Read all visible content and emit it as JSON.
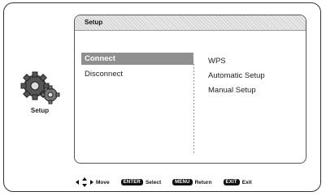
{
  "side": {
    "label": "Setup",
    "icon": "gear-icon"
  },
  "panel": {
    "title": "Setup"
  },
  "menu": {
    "items": [
      {
        "label": "Connect",
        "selected": true
      },
      {
        "label": "Disconnect",
        "selected": false
      }
    ]
  },
  "options": {
    "items": [
      "WPS",
      "Automatic Setup",
      "Manual Setup"
    ]
  },
  "footer": {
    "move_label": "Move",
    "enter_key": "ENTER",
    "enter_label": "Select",
    "menu_key": "MENU",
    "menu_label": "Return",
    "exit_key": "EXIT",
    "exit_label": "Exit"
  },
  "colors": {
    "selected_bg": "#8f8f8f",
    "key_bg": "#111111"
  }
}
